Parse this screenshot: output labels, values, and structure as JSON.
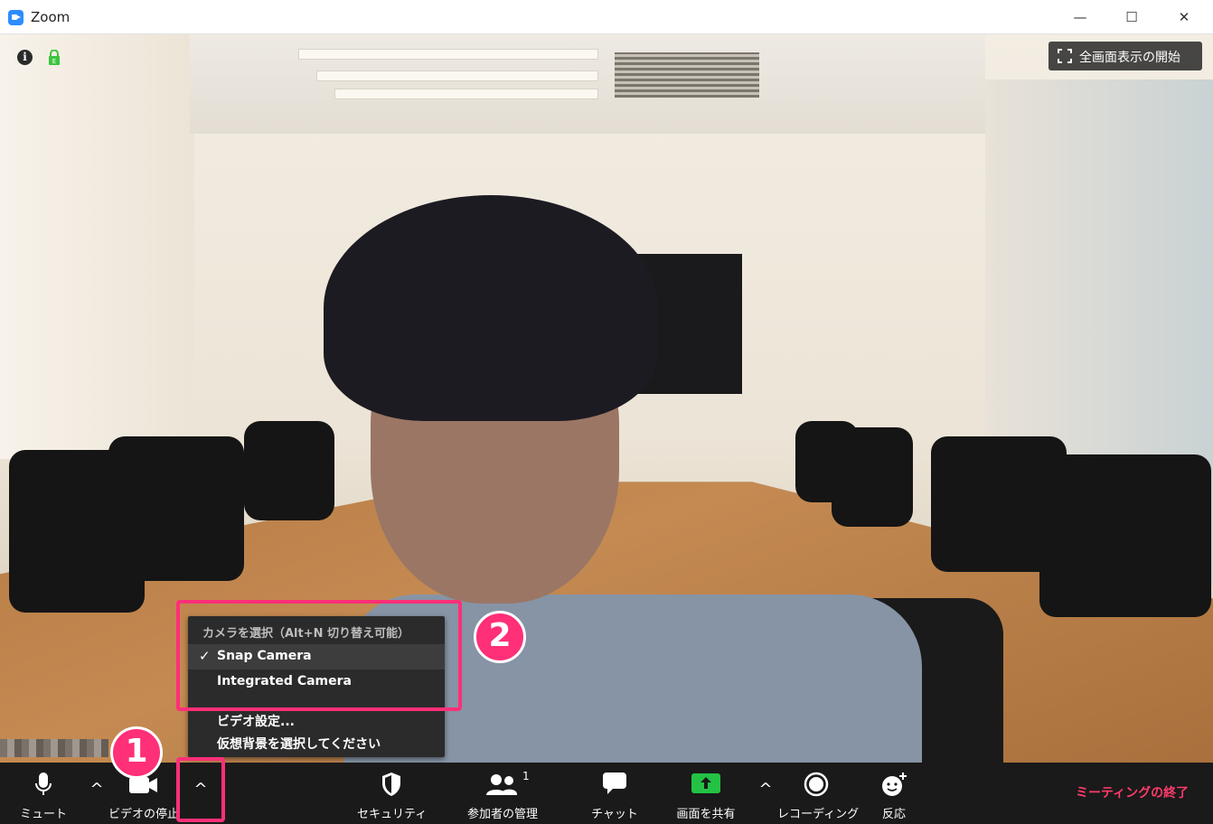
{
  "window": {
    "title": "Zoom",
    "minimize": "—",
    "maximize": "☐",
    "close": "✕"
  },
  "overlay": {
    "info": "i",
    "fullscreen_label": "全画面表示の開始"
  },
  "menu": {
    "header": "カメラを選択（Alt+N 切り替え可能）",
    "check_mark": "✓",
    "items": [
      {
        "label": "Snap Camera",
        "selected": true
      },
      {
        "label": "Integrated Camera",
        "selected": false
      },
      {
        "label": "ビデオ設定..."
      },
      {
        "label": "仮想背景を選択してください"
      }
    ]
  },
  "toolbar": {
    "mute": "ミュート",
    "video": "ビデオの停止",
    "security": "セキュリティ",
    "participants": "参加者の管理",
    "participants_count": "1",
    "chat": "チャット",
    "share": "画面を共有",
    "record": "レコーディング",
    "reactions": "反応",
    "end": "ミーティングの終了",
    "caret": "^"
  },
  "annotations": {
    "step1": "1",
    "step2": "2"
  },
  "colors": {
    "highlight": "#ff2f78",
    "end": "#ff3b6b",
    "share": "#23c244",
    "toolbar": "#1a1a1a"
  }
}
